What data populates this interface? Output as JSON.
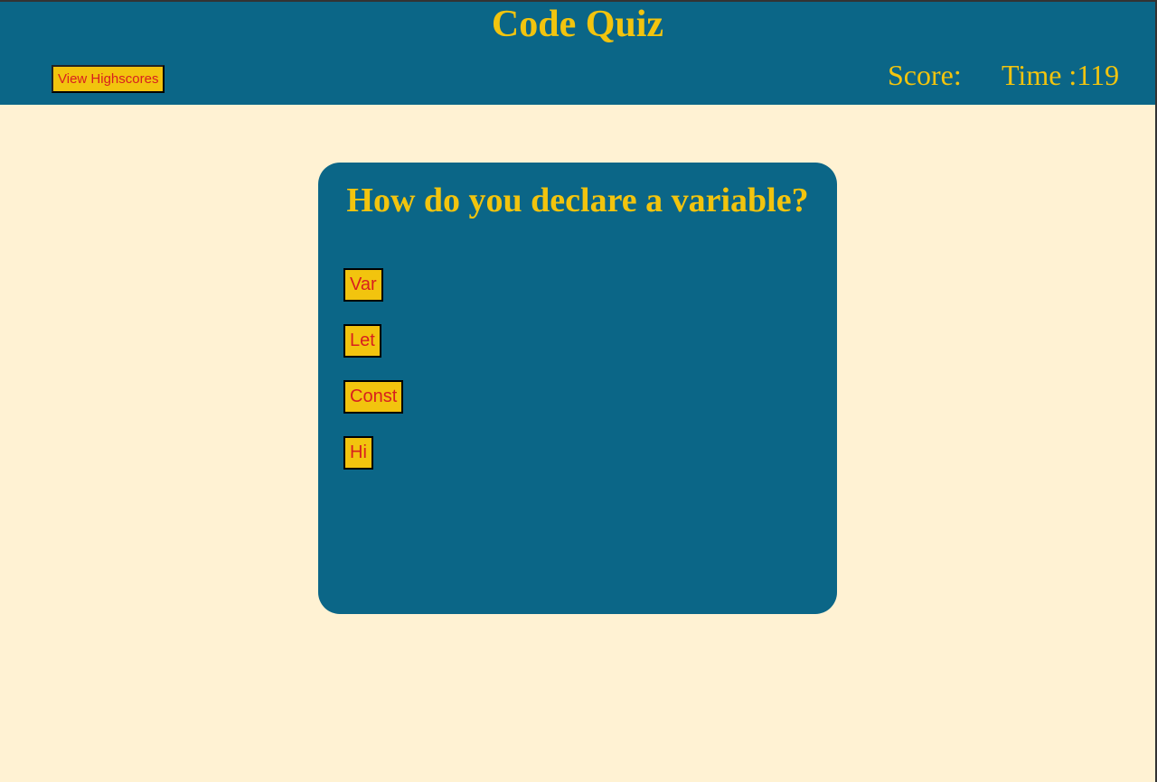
{
  "header": {
    "title": "Code Quiz",
    "highscores_label": "View Highscores",
    "score_text": "Score:",
    "time_text": "Time :119"
  },
  "quiz": {
    "question": "How do you declare a variable?",
    "answers": [
      "Var",
      "Let",
      "Const",
      "Hi"
    ]
  },
  "colors": {
    "header_bg": "#0b6687",
    "page_bg": "#fff2d3",
    "accent_yellow": "#f2c40e",
    "button_text_red": "#d81f1f"
  }
}
